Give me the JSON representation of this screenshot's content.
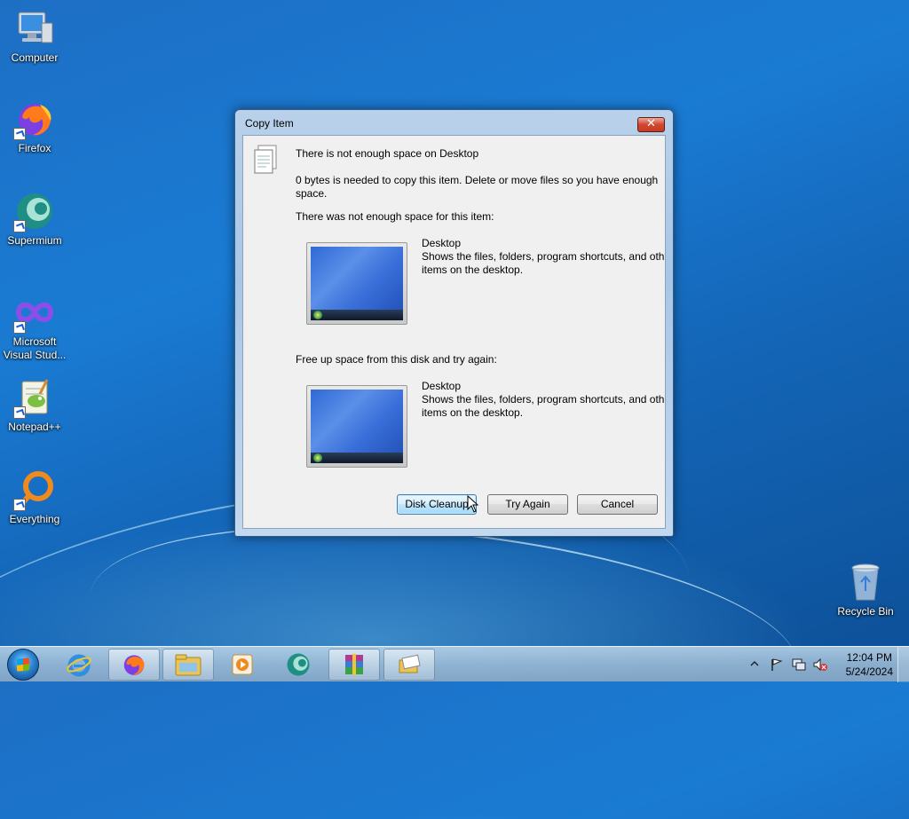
{
  "desktop": {
    "icons": [
      {
        "label_lines": [
          "Computer"
        ],
        "icon": "computer-icon"
      },
      {
        "label_lines": [
          "Firefox"
        ],
        "icon": "firefox-icon"
      },
      {
        "label_lines": [
          "Supermium"
        ],
        "icon": "supermium-icon"
      },
      {
        "label_lines": [
          "Microsoft",
          "Visual Stud..."
        ],
        "icon": "visual-studio-icon"
      },
      {
        "label_lines": [
          "Notepad++"
        ],
        "icon": "notepadpp-icon"
      },
      {
        "label_lines": [
          "Everything"
        ],
        "icon": "everything-icon"
      },
      {
        "label_lines": [
          "Recycle Bin"
        ],
        "icon": "recycle-bin-icon"
      }
    ]
  },
  "dialog": {
    "title": "Copy Item",
    "close_glyph": "✕",
    "heading": "There is not enough space on Desktop",
    "message_line1": "0 bytes is needed to copy this item. Delete or move files so you have enough",
    "message_line2": "space.",
    "not_enough_label": "There was not enough space for this item:",
    "item1": {
      "name": "Desktop",
      "desc_line1": "Shows the files, folders, program shortcuts, and othe",
      "desc_line2": "items on the desktop."
    },
    "free_up_label": "Free up space from this disk and try again:",
    "item2": {
      "name": "Desktop",
      "desc_line1": "Shows the files, folders, program shortcuts, and othe",
      "desc_line2": "items on the desktop."
    },
    "buttons": {
      "disk_cleanup": "Disk Cleanup",
      "try_again": "Try Again",
      "cancel": "Cancel"
    }
  },
  "taskbar": {
    "pinned": [
      "internet-explorer-icon",
      "firefox-icon",
      "file-explorer-icon",
      "media-player-icon",
      "supermium-icon",
      "winrar-icon",
      "copy-dialog-icon"
    ],
    "clock": {
      "time": "12:04 PM",
      "date": "5/24/2024"
    }
  },
  "colors": {
    "dialog_frame": "#b9d1ea",
    "close_red": "#c73a23",
    "default_button": "#3c7fb1",
    "desktop_blue": "#1a7bd3"
  }
}
